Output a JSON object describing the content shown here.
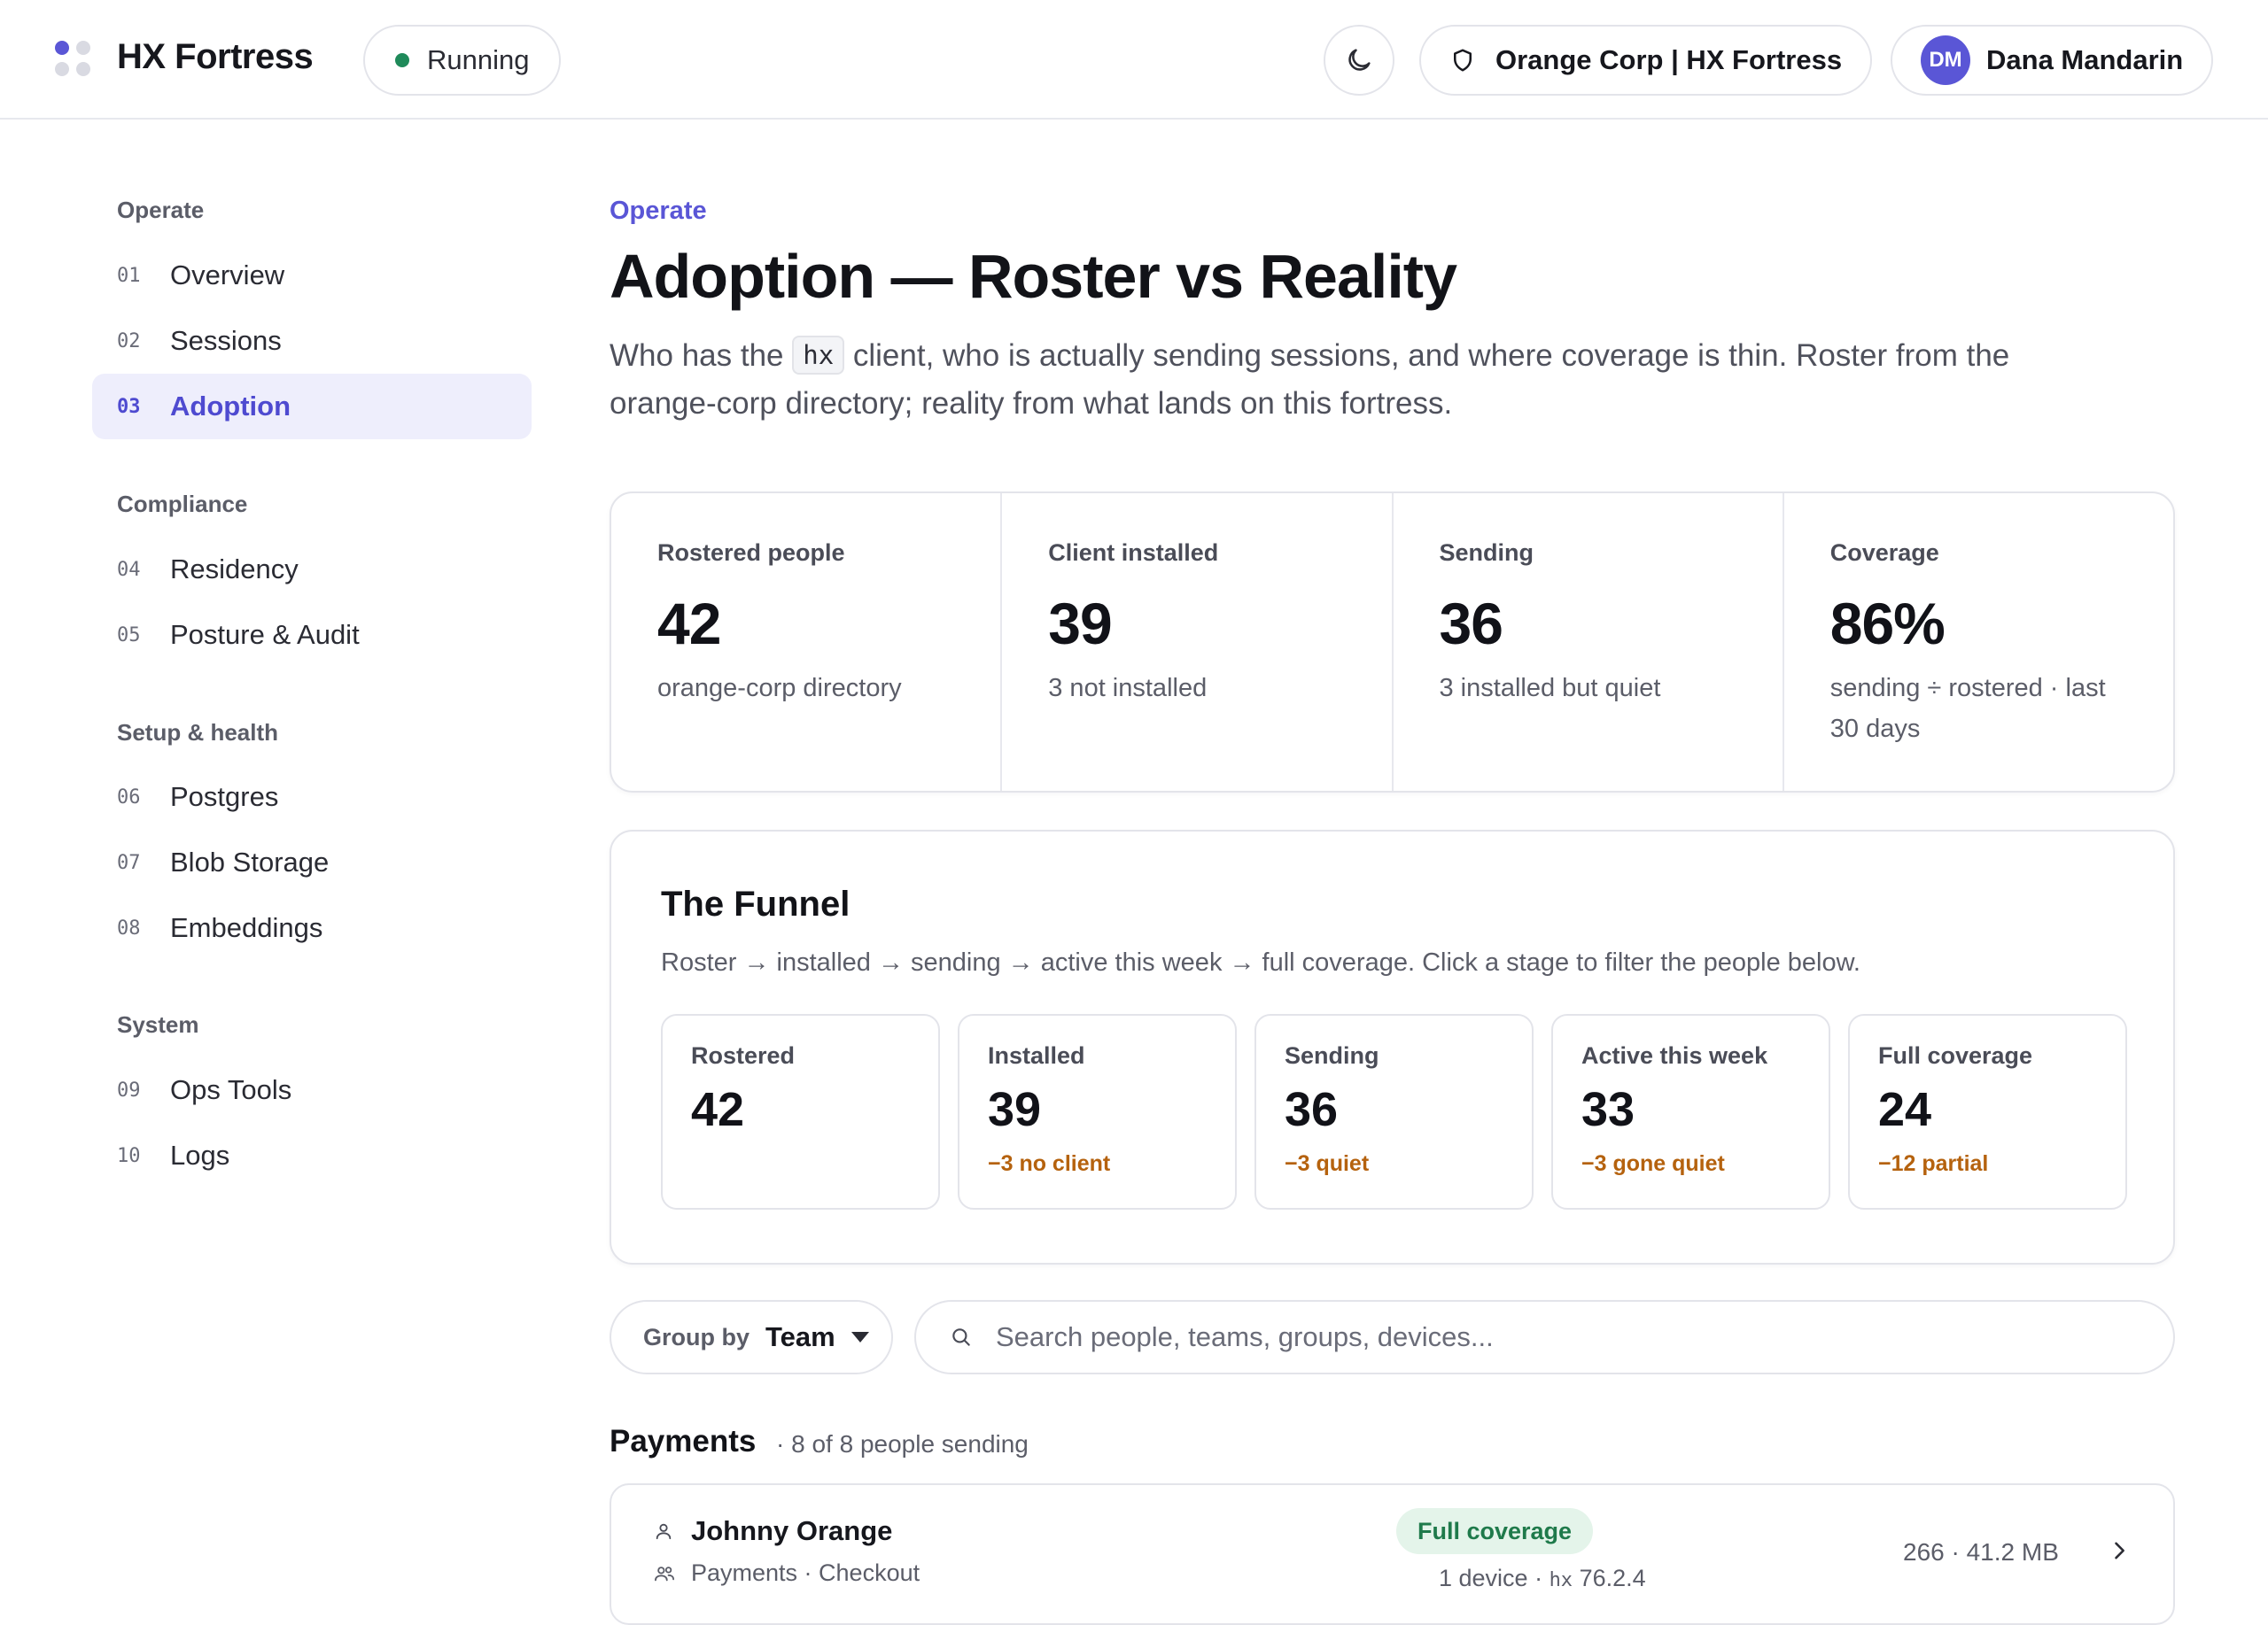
{
  "app": {
    "name": "HX Fortress",
    "status": "Running",
    "org": "Orange Corp | HX Fortress",
    "user_initials": "DM",
    "user_name": "Dana Mandarin",
    "accent": "#5a56d6",
    "status_color": "#1f8a5a"
  },
  "icons": {
    "theme": "moon-icon",
    "org": "shield-icon",
    "search": "search-icon",
    "person": "person-icon",
    "team": "users-icon",
    "chevron": "chevron-right-icon"
  },
  "sidebar": {
    "sections": [
      {
        "title": "Operate",
        "items": [
          {
            "num": "01",
            "label": "Overview"
          },
          {
            "num": "02",
            "label": "Sessions"
          },
          {
            "num": "03",
            "label": "Adoption",
            "active": true
          }
        ]
      },
      {
        "title": "Compliance",
        "items": [
          {
            "num": "04",
            "label": "Residency"
          },
          {
            "num": "05",
            "label": "Posture & Audit"
          }
        ]
      },
      {
        "title": "Setup & health",
        "items": [
          {
            "num": "06",
            "label": "Postgres"
          },
          {
            "num": "07",
            "label": "Blob Storage"
          },
          {
            "num": "08",
            "label": "Embeddings"
          }
        ]
      },
      {
        "title": "System",
        "items": [
          {
            "num": "09",
            "label": "Ops Tools"
          },
          {
            "num": "10",
            "label": "Logs"
          }
        ]
      }
    ]
  },
  "page": {
    "eyebrow": "Operate",
    "title": "Adoption — Roster vs Reality",
    "desc_before": "Who has the ",
    "desc_code": "hx",
    "desc_after": " client, who is actually sending sessions, and where coverage is thin. Roster from the orange-corp directory; reality from what lands on this fortress."
  },
  "stats": [
    {
      "label": "Rostered people",
      "value": "42",
      "sub": "orange-corp directory"
    },
    {
      "label": "Client installed",
      "value": "39",
      "sub": "3 not installed"
    },
    {
      "label": "Sending",
      "value": "36",
      "sub": "3 installed but quiet"
    },
    {
      "label": "Coverage",
      "value": "86%",
      "sub": "sending ÷ rostered · last 30 days"
    }
  ],
  "funnel": {
    "title": "The Funnel",
    "subtitle": "Roster → installed → sending → active this week → full coverage. Click a stage to filter the people below.",
    "stages": [
      {
        "label": "Rostered",
        "value": "42",
        "delta": ""
      },
      {
        "label": "Installed",
        "value": "39",
        "delta": "−3 no client"
      },
      {
        "label": "Sending",
        "value": "36",
        "delta": "−3 quiet"
      },
      {
        "label": "Active this week",
        "value": "33",
        "delta": "−3 gone quiet"
      },
      {
        "label": "Full coverage",
        "value": "24",
        "delta": "−12 partial"
      }
    ],
    "delta_color": "#b5620e"
  },
  "filters": {
    "group_by_label": "Group by",
    "group_by_value": "Team",
    "search_placeholder": "Search people, teams, groups, devices..."
  },
  "group": {
    "title": "Payments",
    "meta": "· 8 of 8 people sending",
    "people": [
      {
        "name": "Johnny Orange",
        "team": "Payments · Checkout",
        "badge": "Full coverage",
        "devices_prefix": "1 device · ",
        "client_label": "hx",
        "client_version": " 76.2.4",
        "stats": "266 · 41.2 MB"
      }
    ]
  }
}
